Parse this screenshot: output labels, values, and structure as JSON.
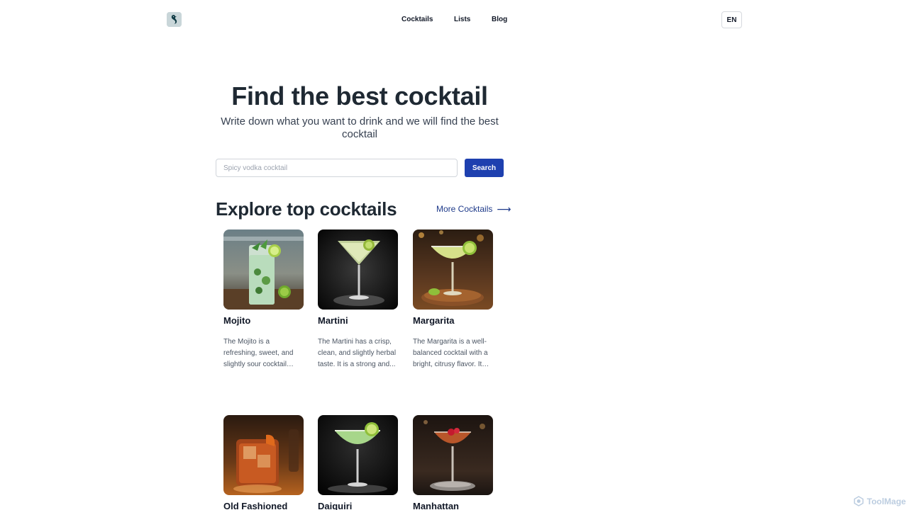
{
  "header": {
    "logo_icon": "bird-logo-icon",
    "nav": [
      "Cocktails",
      "Lists",
      "Blog"
    ],
    "lang": "EN"
  },
  "hero": {
    "title": "Find the best cocktail",
    "subtitle": "Write down what you want to drink and we will find the best cocktail"
  },
  "search": {
    "placeholder": "Spicy vodka cocktail",
    "value": "",
    "button": "Search"
  },
  "section": {
    "title": "Explore top cocktails",
    "more_link": "More Cocktails",
    "more_icon": "arrow-right-icon"
  },
  "cocktails": [
    {
      "name": "Mojito",
      "description": "The Mojito is a refreshing, sweet, and slightly sour cocktail with..."
    },
    {
      "name": "Martini",
      "description": "The Martini has a crisp, clean, and slightly herbal taste. It is a strong and..."
    },
    {
      "name": "Margarita",
      "description": "The Margarita is a well-balanced cocktail with a bright, citrusy flavor. It is..."
    },
    {
      "name": "Old Fashioned",
      "description": ""
    },
    {
      "name": "Daiquiri",
      "description": ""
    },
    {
      "name": "Manhattan",
      "description": ""
    }
  ],
  "watermark": "ToolMage",
  "colors": {
    "primary": "#1e40af",
    "link": "#1e3a8a",
    "text": "#1f2933"
  }
}
